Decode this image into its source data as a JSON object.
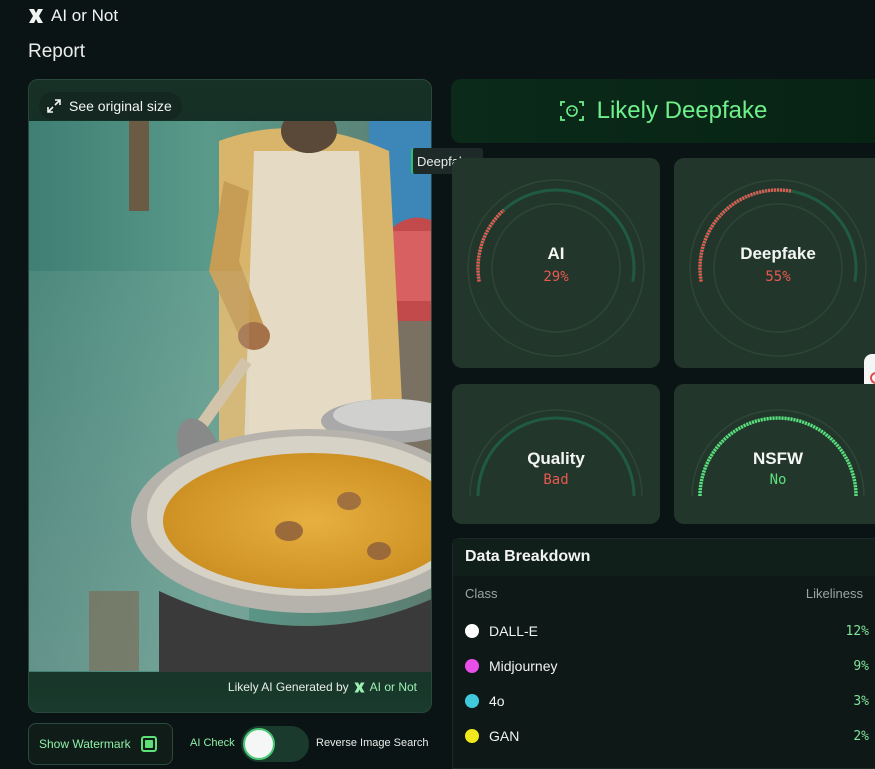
{
  "app": {
    "name": "AI or Not",
    "page_title": "Report"
  },
  "image_panel": {
    "see_original_label": "See original size",
    "attribution_prefix": "Likely AI Generated by",
    "attribution_brand": "AI or Not",
    "overlay_tag": "Deepfake"
  },
  "controls": {
    "show_watermark_label": "Show Watermark",
    "watermark_checked": true,
    "ai_check_label": "AI Check",
    "ai_check_on": false,
    "reverse_search_label": "Reverse Image Search"
  },
  "verdict": {
    "label": "Likely Deepfake",
    "color": "#6ef08a"
  },
  "gauges": {
    "ai": {
      "title": "AI",
      "value": "29%",
      "fraction": 0.29,
      "color": "#e8594f"
    },
    "deepfake": {
      "title": "Deepfake",
      "value": "55%",
      "fraction": 0.55,
      "color": "#e8594f"
    },
    "quality": {
      "title": "Quality",
      "value": "Bad",
      "fraction": 0.0,
      "color": "#e8594f"
    },
    "nsfw": {
      "title": "NSFW",
      "value": "No",
      "fraction": 1.0,
      "color": "#5ee07a"
    }
  },
  "breakdown": {
    "title": "Data Breakdown",
    "col_class": "Class",
    "col_likeliness": "Likeliness",
    "rows": [
      {
        "name": "DALL-E",
        "value": "12%",
        "color": "#ffffff"
      },
      {
        "name": "Midjourney",
        "value": "9%",
        "color": "#e84ee8"
      },
      {
        "name": "4o",
        "value": "3%",
        "color": "#40c8dd"
      },
      {
        "name": "GAN",
        "value": "2%",
        "color": "#f0e81a"
      }
    ]
  }
}
